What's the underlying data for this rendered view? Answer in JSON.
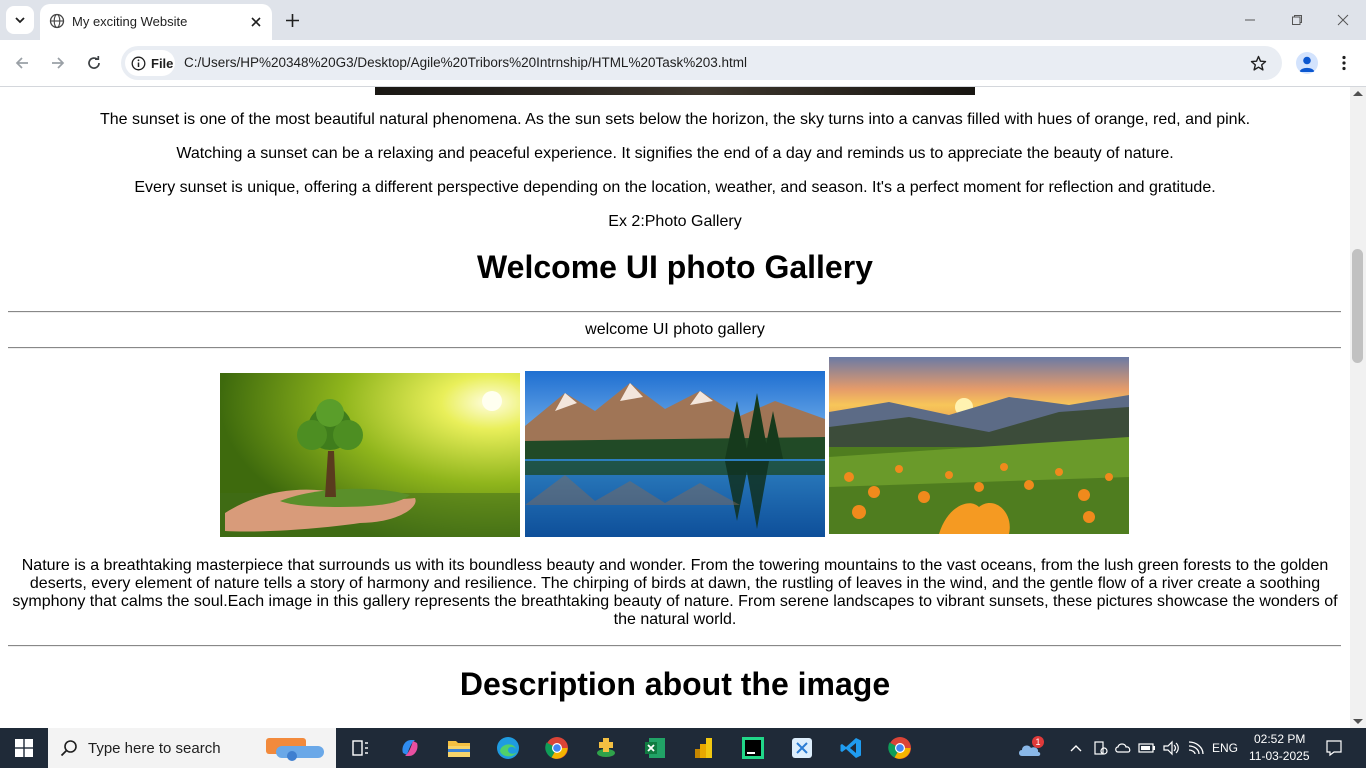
{
  "browser": {
    "tab_title": "My exciting Website",
    "site_chip_label": "File",
    "url": "C:/Users/HP%20348%20G3/Desktop/Agile%20Tribors%20Intrnship/HTML%20Task%203.html"
  },
  "page": {
    "sunset_paragraphs": [
      "The sunset is one of the most beautiful natural phenomena. As the sun sets below the horizon, the sky turns into a canvas filled with hues of orange, red, and pink.",
      "Watching a sunset can be a relaxing and peaceful experience. It signifies the end of a day and reminds us to appreciate the beauty of nature.",
      "Every sunset is unique, offering a different perspective depending on the location, weather, and season. It's a perfect moment for reflection and gratitude."
    ],
    "exercise_label": "Ex 2:Photo Gallery",
    "gallery_heading": "Welcome UI photo Gallery",
    "gallery_subheading": "welcome UI photo gallery",
    "gallery_images": [
      "tree-in-hands-image",
      "mountain-lake-image",
      "sunset-meadow-image"
    ],
    "nature_paragraph": "Nature is a breathtaking masterpiece that surrounds us with its boundless beauty and wonder. From the towering mountains to the vast oceans, from the lush green forests to the golden deserts, every element of nature tells a story of harmony and resilience. The chirping of birds at dawn, the rustling of leaves in the wind, and the gentle flow of a river create a soothing symphony that calms the soul.Each image in this gallery represents the breathtaking beauty of nature. From serene landscapes to vibrant sunsets, these pictures showcase the wonders of the natural world.",
    "description_heading": "Description about the image"
  },
  "taskbar": {
    "search_placeholder": "Type here to search",
    "language": "ENG",
    "time": "02:52 PM",
    "date": "11-03-2025",
    "weather_badge": "1"
  },
  "colors": {
    "chrome_tabbar": "#dfe3ea",
    "omnibox": "#e9edf3",
    "taskbar": "#1f2a38"
  }
}
